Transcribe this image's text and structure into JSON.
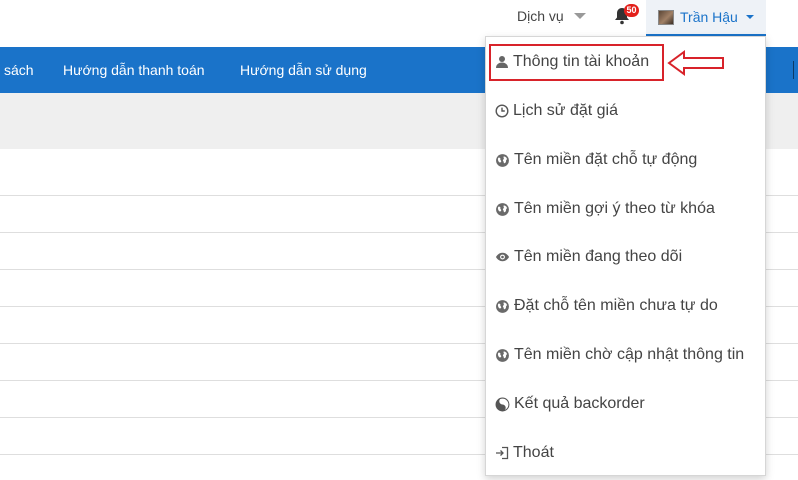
{
  "header": {
    "services_label": "Dịch vụ",
    "notification_count": "50",
    "user_name": "Trần Hậu"
  },
  "nav": {
    "items": [
      {
        "label": "sách"
      },
      {
        "label": "Hướng dẫn thanh toán"
      },
      {
        "label": "Hướng dẫn sử dụng"
      }
    ]
  },
  "user_menu": {
    "items": [
      {
        "label": "Thông tin tài khoản",
        "icon": "user-icon"
      },
      {
        "label": "Lịch sử đặt giá",
        "icon": "clock-icon"
      },
      {
        "label": "Tên miền đặt chỗ tự động",
        "icon": "globe-icon"
      },
      {
        "label": "Tên miền gợi ý theo từ khóa",
        "icon": "globe-icon"
      },
      {
        "label": "Tên miền đang theo dõi",
        "icon": "eye-icon"
      },
      {
        "label": "Đặt chỗ tên miền chưa tự do",
        "icon": "globe-icon"
      },
      {
        "label": "Tên miền chờ cập nhật thông tin",
        "icon": "globe-icon"
      },
      {
        "label": "Kết quả backorder",
        "icon": "yin-yang-icon"
      },
      {
        "label": "Thoát",
        "icon": "log-out-icon"
      }
    ]
  },
  "colors": {
    "nav_background": "#1a73c9",
    "highlight_red": "#d8232a",
    "badge_red": "#e3201b"
  }
}
